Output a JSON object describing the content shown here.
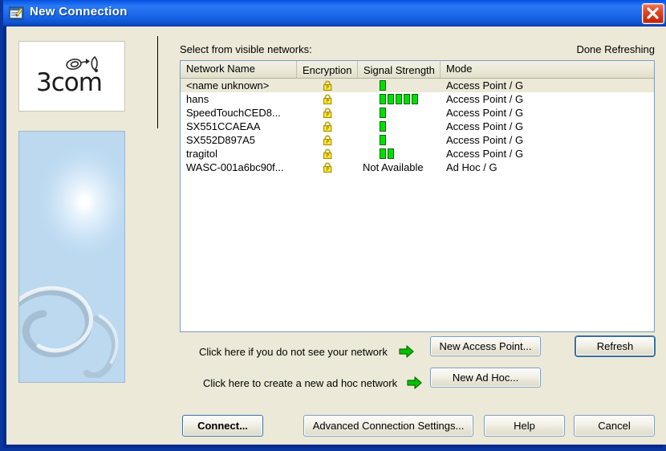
{
  "window": {
    "title": "New Connection",
    "title_icon": "window-pencil-icon",
    "close_label": "Close",
    "close_icon": "close-icon",
    "accent_titlebar": "#1f6ff0",
    "client_bg": "#ece9d8"
  },
  "branding": {
    "logo_word": "3com",
    "logo_mark": "3com-swirl-icon",
    "art_alt": "blue-abstract-graphic"
  },
  "main": {
    "select_label": "Select from visible networks:",
    "status_label": "Done Refreshing"
  },
  "network_list": {
    "columns": [
      "Network Name",
      "Encryption",
      "Signal Strength",
      "Mode"
    ],
    "rows": [
      {
        "name": "<name unknown>",
        "encryption": "lock-icon",
        "signal_bars": 1,
        "signal_text": "",
        "mode": "Access Point / G",
        "selected": true
      },
      {
        "name": "hans",
        "encryption": "lock-icon",
        "signal_bars": 5,
        "signal_text": "",
        "mode": "Access Point / G",
        "selected": false
      },
      {
        "name": "SpeedTouchCED8...",
        "encryption": "lock-icon",
        "signal_bars": 1,
        "signal_text": "",
        "mode": "Access Point / G",
        "selected": false
      },
      {
        "name": "SX551CCAEAA",
        "encryption": "lock-icon",
        "signal_bars": 1,
        "signal_text": "",
        "mode": "Access Point / G",
        "selected": false
      },
      {
        "name": "SX552D897A5",
        "encryption": "lock-icon",
        "signal_bars": 1,
        "signal_text": "",
        "mode": "Access Point / G",
        "selected": false
      },
      {
        "name": "tragitol",
        "encryption": "lock-icon",
        "signal_bars": 2,
        "signal_text": "",
        "mode": "Access Point / G",
        "selected": false
      },
      {
        "name": "WASC-001a6bc90f...",
        "encryption": "lock-icon",
        "signal_bars": 0,
        "signal_text": "Not Available",
        "mode": "Ad Hoc / G",
        "selected": false
      }
    ],
    "signal_bar_color": "#00e000",
    "selected_row_color": "#ece9d8"
  },
  "hints": [
    {
      "text": "Click here if you do not see your network",
      "arrow": "green-arrow-right-icon"
    },
    {
      "text": "Click here to create a new ad hoc network",
      "arrow": "green-arrow-right-icon"
    }
  ],
  "buttons": {
    "new_access_point": "New Access Point...",
    "new_ad_hoc": "New Ad Hoc...",
    "refresh": "Refresh",
    "connect": "Connect...",
    "advanced": "Advanced Connection Settings...",
    "help": "Help",
    "cancel": "Cancel"
  }
}
